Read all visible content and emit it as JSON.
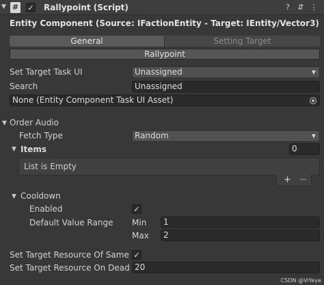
{
  "header": {
    "fold_glyph": "▼",
    "script_icon_glyph": "#",
    "enabled_check": "✓",
    "title": "Rallypoint (Script)",
    "help_glyph": "?",
    "settings_glyph": "⇵",
    "more_glyph": "⋮"
  },
  "component_label": "Entity Component (Source: IFactionEntity - Target: IEntity/Vector3)",
  "tabs": {
    "general": "General",
    "setting_target": "Setting Target"
  },
  "rallypoint_button": "Rallypoint",
  "fields": {
    "set_target_task_ui": {
      "label": "Set Target Task UI",
      "value": "Unassigned"
    },
    "search": {
      "label": "Search",
      "value": "Unassigned"
    },
    "task_ui_asset": {
      "value": "None (Entity Component Task UI Asset)"
    }
  },
  "order_audio": {
    "label": "Order Audio",
    "fold_glyph": "▼",
    "fetch_type": {
      "label": "Fetch Type",
      "value": "Random"
    },
    "items": {
      "label": "Items",
      "count": "0",
      "fold_glyph": "▼",
      "empty_text": "List is Empty"
    },
    "add_glyph": "+",
    "remove_glyph": "−"
  },
  "cooldown": {
    "label": "Cooldown",
    "fold_glyph": "▼",
    "enabled": {
      "label": "Enabled",
      "check": "✓"
    },
    "default_value_range": {
      "label": "Default Value Range",
      "min_label": "Min",
      "min": "1",
      "max_label": "Max",
      "max": "2"
    }
  },
  "set_target_resource_same": {
    "label": "Set Target Resource Of Same T",
    "check": "✓"
  },
  "set_target_resource_dead": {
    "label": "Set Target Resource On Dead R",
    "value": "20"
  },
  "watermark": "CSDN @ViYeye",
  "dropdown_arrow": "▼"
}
